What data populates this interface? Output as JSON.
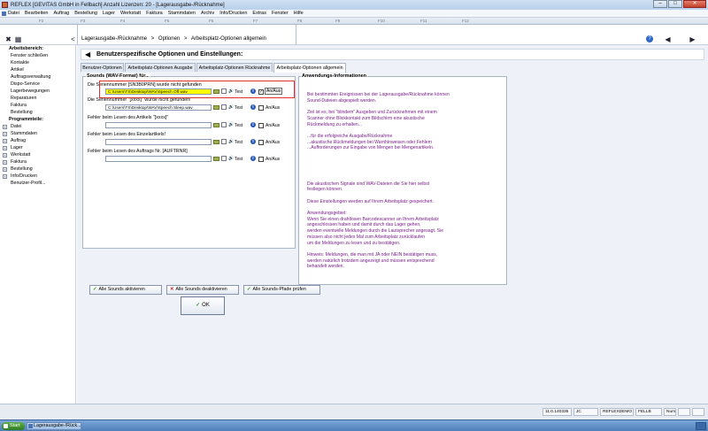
{
  "window": {
    "title": "REFLEX [GEVITAS GmbH in Fellbach] Anzahl Lizenzen: 20 - [Lagerausgabe-/Rücknahme]",
    "buttons": [
      "–",
      "□",
      "✕"
    ]
  },
  "menubar": [
    "Datei",
    "Bearbeiten",
    "Auftrag",
    "Bestellung",
    "Lager",
    "Werkstatt",
    "Faktura",
    "Stammdaten",
    "Archiv",
    "Info/Drucken",
    "Extras",
    "Fenster",
    "Hilfe"
  ],
  "fkeys": [
    "F2",
    "F3",
    "F4",
    "F5",
    "F6",
    "F7",
    "F8",
    "F9",
    "F10",
    "F11",
    "F12"
  ],
  "breadcrumb": [
    "Lagerausgabe-/Rücknahme",
    ">",
    "Optionen",
    ">",
    "Arbeitsplatz-Optionen allgemein"
  ],
  "sidebar": {
    "section1": "Arbeitsbereich:",
    "items1": [
      "Fenster schließen",
      "Kontakte",
      "Artikel",
      "Auftragsverwaltung",
      "Dispo-Service",
      "Lagerbewegungen",
      "Reparaturen",
      "Faktura",
      "Bestellung"
    ],
    "section2": "Programmteile:",
    "items2": [
      "Datei",
      "Stammdaten",
      "Auftrag",
      "Lager",
      "Werkstatt",
      "Faktura",
      "Bestellung",
      "Info/Drucken",
      "Benutzer-Profil..."
    ]
  },
  "main": {
    "title": "Benutzerspezifische Optionen und Einstellungen:",
    "tabs": [
      "Benutzer-Optionen",
      "Arbeitsplatz-Optionen Ausgabe",
      "Arbeitsplatz-Optionen Rücknahme",
      "Arbeitsplatz-Optionen allgemein"
    ],
    "sounds": {
      "legend": "Sounds (WAV-Format) für...",
      "rows": [
        {
          "label": "Die Seriennummer [SN3B0PRN] wurde nicht gefunden",
          "path": "C:\\Users\\TS\\Desktop\\WAV\\Speech Off.wav",
          "checked": true
        },
        {
          "label": "Die Seriennummer \"[xxxx]\" wurde nicht gefunden!",
          "path": "C:\\Users\\TS\\Desktop\\WAV\\Speech Sleep.wav",
          "checked": false
        },
        {
          "label": "Fehler beim Lesen des Artikels \"[xxxx]\"",
          "path": "",
          "checked": false
        },
        {
          "label": "Fehler beim Lesen des Einzelartikels!",
          "path": "",
          "checked": false
        },
        {
          "label": "Fehler beim Lesen des Auftrags Nr. [AUFTRNR]",
          "path": "",
          "checked": false
        }
      ],
      "test_label": "Test",
      "an_aus_label": "An/Aus"
    },
    "info": {
      "legend": "Anwendungs-Informationen",
      "lines": [
        "Bei bestimmten Ereignissen bei der Lagerausgabe/Rücknahme können",
        "Sound-Dateien abgespielt werden.",
        "",
        "Ziel ist es, bei \"blindem\" Ausgeben und Zurücknehmen mit einem",
        "Scanner ohne Blickkontakt zum Bildschirm eine akustische",
        "Rückmeldung zu erhalten...",
        "",
        "...für die erfolgreiche Ausgabe/Rücknahme",
        "...akustische Rückmeldungen bei Warnhinweisen oder Fehlern",
        "...Aufforderungen zur Eingabe von Mengen bei Mengenartikeln.",
        "",
        "",
        "",
        "",
        "",
        "Die akustischen Signale sind WAV-Dateien die Sie hier selbst",
        "festlegen können.",
        "",
        "Diese Einstellungen werden auf Ihrem Arbeitsplatz gespeichert.",
        "",
        "Anwendungsgebiet:",
        "Wenn Sie einen drahtlosen Barcodescanner an Ihrem Arbeitsplatz",
        "angeschlossen haben und damit durch das Lager gehen,",
        "werden eventuelle Meldungen durch die Lautsprecher angesagt. Sie",
        "müssen also nicht jedes Mal zum Arbeitsplatz zurücklaufen",
        "um die Meldungen zu lesen und zu bestätigen.",
        "",
        "Hinweis: Meldungen, die man mit JA oder NEIN bestätigen muss,",
        "werden natürlich trotzdem angezeigt und müssen entsprechend",
        "behandelt werden."
      ]
    },
    "buttons": {
      "activate_all": "Alle Sounds aktivieren",
      "deactivate_all": "Alle Sounds deaktivieren",
      "check_paths": "Alle Sounds-Pfade prüfen",
      "ok": "OK"
    }
  },
  "statusbar": [
    "11.0.140335",
    "JC",
    "REFLEXDEMO",
    "FELLB",
    "Num",
    "",
    ""
  ],
  "taskbar": {
    "start": "Start",
    "item": "Lagerausgabe-/Rück..."
  },
  "colors": {
    "highlight": "#ffff00",
    "callout": "#e03030",
    "info_text": "#7a1e8a"
  }
}
